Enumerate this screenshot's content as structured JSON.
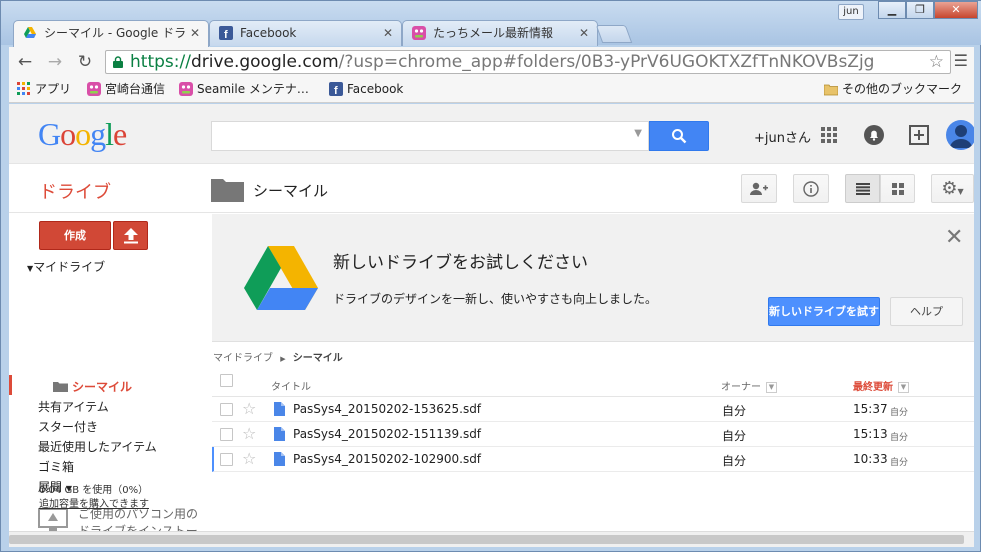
{
  "browser": {
    "user_badge": "jun",
    "tabs": [
      {
        "label": "シーマイル - Google ドラ",
        "icon": "google-drive-icon"
      },
      {
        "label": "Facebook",
        "icon": "facebook-icon"
      },
      {
        "label": "たっちメール最新情報",
        "icon": "touchmail-icon"
      }
    ],
    "url": {
      "scheme": "https://",
      "host": "drive.google.com",
      "path": "/?usp=chrome_app#folders/0B3-yPrV6UGOKTXZfTnNKOVBsZjg"
    },
    "bookmarks": [
      "アプリ",
      "宮崎台通信",
      "Seamile メンテナ…",
      "Facebook"
    ],
    "other_bookmarks": "その他のブックマーク"
  },
  "gheader": {
    "user": "+junさん"
  },
  "drivebar": {
    "title": "ドライブ",
    "folder": "シーマイル"
  },
  "sidebar": {
    "create": "作成",
    "my_drive": "マイドライブ",
    "current": "シーマイル",
    "items": [
      "共有アイテム",
      "スター付き",
      "最近使用したアイテム",
      "ゴミ箱",
      "展開"
    ],
    "install_line1": "ご使用のパソコン用の",
    "install_line2": "ドライブをインストール",
    "quota_used": "0.04 GB を使用（0%）",
    "quota_buy": "追加容量を購入できます"
  },
  "promo": {
    "title": "新しいドライブをお試しください",
    "text": "ドライブのデザインを一新し、使いやすさも向上しました。",
    "try_button": "新しいドライブを試す",
    "help_button": "ヘルプ"
  },
  "breadcrumb": {
    "root": "マイドライブ",
    "current": "シーマイル"
  },
  "table": {
    "headers": {
      "title": "タイトル",
      "owner": "オーナー",
      "modified": "最終更新"
    },
    "rows": [
      {
        "name": "PasSys4_20150202-153625.sdf",
        "owner": "自分",
        "time": "15:37",
        "by": "自分"
      },
      {
        "name": "PasSys4_20150202-151139.sdf",
        "owner": "自分",
        "time": "15:13",
        "by": "自分"
      },
      {
        "name": "PasSys4_20150202-102900.sdf",
        "owner": "自分",
        "time": "10:33",
        "by": "自分"
      }
    ]
  },
  "colors": {
    "accent_red": "#dd4b39",
    "blue_button": "#4d90fe"
  }
}
